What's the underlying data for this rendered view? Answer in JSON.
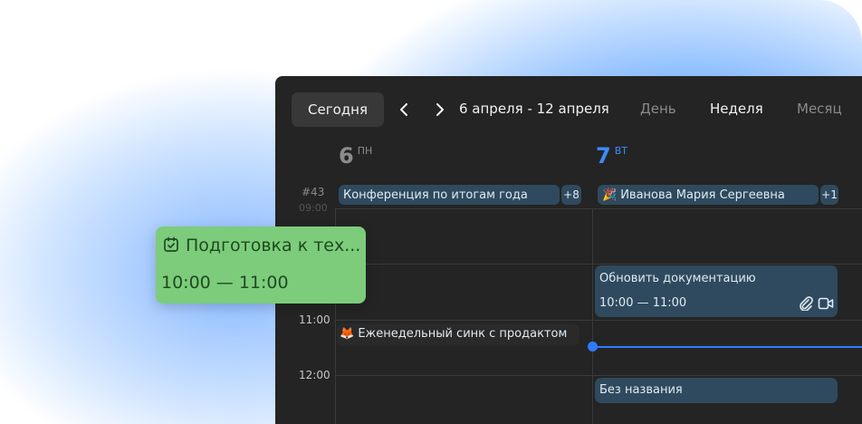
{
  "toolbar": {
    "today_label": "Сегодня",
    "range_label": "6 апреля - 12 апреля",
    "views": [
      {
        "label": "День",
        "active": false
      },
      {
        "label": "Неделя",
        "active": true
      },
      {
        "label": "Месяц",
        "active": false
      }
    ]
  },
  "days": [
    {
      "number": "6",
      "weekday": "ПН",
      "today": false
    },
    {
      "number": "7",
      "weekday": "ВТ",
      "today": true
    }
  ],
  "week_number": "#43",
  "all_day": {
    "day1": {
      "title": "Конференция по итогам года",
      "more": "+8"
    },
    "day2": {
      "emoji": "🎉",
      "title": "Иванова Мария Сергеевна",
      "more": "+1"
    }
  },
  "time_labels": {
    "faded": "09:00",
    "t11": "11:00",
    "t12": "12:00"
  },
  "events": {
    "docs": {
      "title": "Обновить документацию",
      "time": "10:00 — 11:00",
      "icons": [
        "paperclip-icon",
        "video-icon"
      ]
    },
    "sync": {
      "emoji": "🦊",
      "title": "Еженедельный синк с продактом"
    },
    "untitled": {
      "title": "Без названия"
    }
  },
  "dragged_event": {
    "icon": "calendar-check-icon",
    "title": "Подготовка к тех...",
    "time": "10:00 — 11:00"
  },
  "colors": {
    "accent": "#2e7bff",
    "event_bg": "#2f4a5e",
    "dragged_bg": "#7ccc7c",
    "calendar_bg": "#242424"
  }
}
